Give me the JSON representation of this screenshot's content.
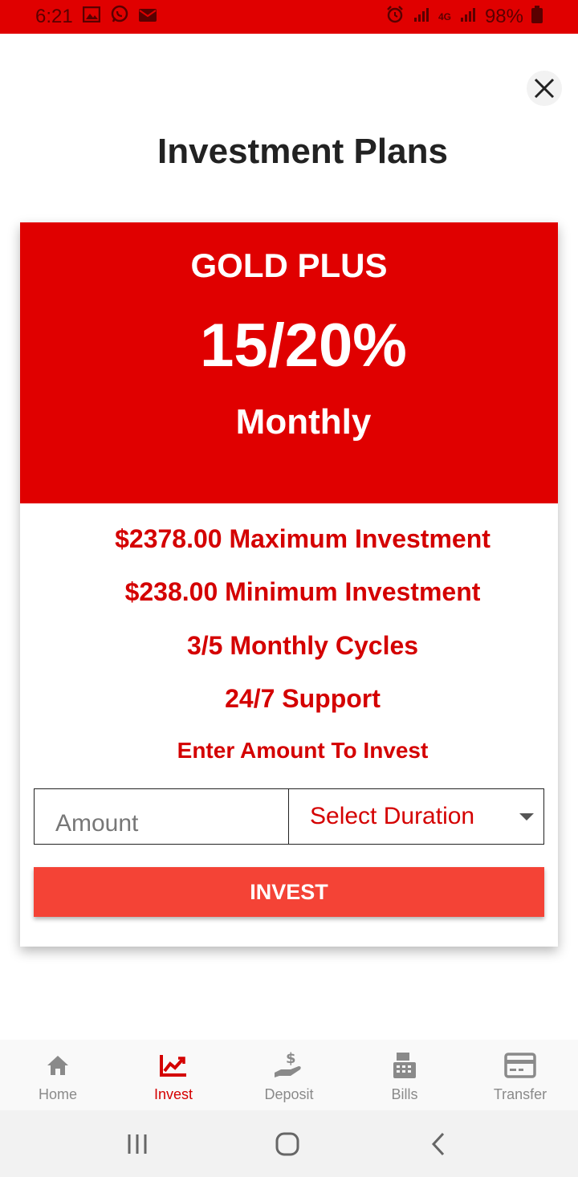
{
  "status_bar": {
    "time": "6:21",
    "battery": "98%",
    "network": "4G",
    "icons": [
      "gallery-icon",
      "whatsapp-icon",
      "mail-icon",
      "alarm-icon",
      "signal-icon",
      "battery-icon"
    ]
  },
  "page": {
    "title": "Investment Plans"
  },
  "plan": {
    "name": "GOLD PLUS",
    "rate": "15/20%",
    "period": "Monthly",
    "features": [
      "$2378.00 Maximum Investment",
      "$238.00 Minimum Investment",
      "3/5 Monthly Cycles",
      "24/7 Support"
    ],
    "enter_label": "Enter Amount To Invest"
  },
  "form": {
    "amount_placeholder": "Amount",
    "amount_value": "",
    "duration_selected": "Select Duration",
    "invest_label": "INVEST"
  },
  "bottom_nav": {
    "items": [
      {
        "label": "Home",
        "icon": "home-icon",
        "active": false
      },
      {
        "label": "Invest",
        "icon": "chart-icon",
        "active": true
      },
      {
        "label": "Deposit",
        "icon": "deposit-icon",
        "active": false
      },
      {
        "label": "Bills",
        "icon": "cash-register-icon",
        "active": false
      },
      {
        "label": "Transfer",
        "icon": "credit-card-icon",
        "active": false
      }
    ]
  },
  "colors": {
    "brand_red": "#e00000",
    "text_red": "#d40000",
    "button_red": "#f44336",
    "inactive_gray": "#8a8a8a"
  }
}
